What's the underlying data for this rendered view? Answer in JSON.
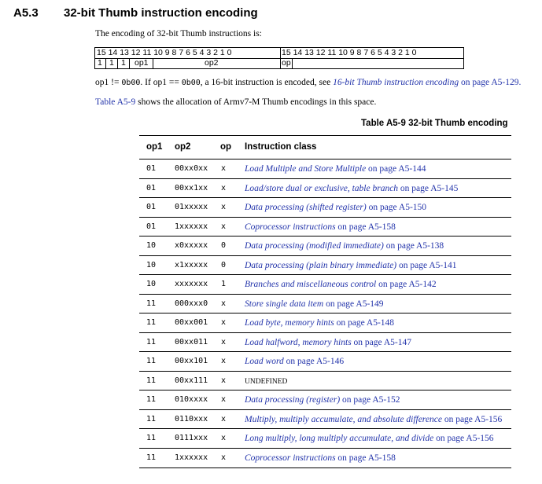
{
  "section": {
    "number": "A5.3",
    "title": "32-bit Thumb instruction encoding"
  },
  "intro": "The encoding of 32-bit Thumb instructions is:",
  "encoding": {
    "bits_hw1": "15 14 13 12 11 10  9  8  7  6  5  4  3  2  1  0",
    "bits_hw2": "15 14 13 12 11 10  9  8  7  6  5  4  3  2  1  0",
    "field_1": "1",
    "field_2": "1",
    "field_3": "1",
    "field_op1": "op1",
    "field_op2": "op2",
    "field_op": "op"
  },
  "para1": {
    "t1": "op1 != ",
    "c1": "0b00",
    "t2": ". If op1 == ",
    "c2": "0b00",
    "t3": ", a 16-bit instruction is encoded, see ",
    "link": "16-bit Thumb instruction encoding",
    "t4": " on page A5-129."
  },
  "para2": {
    "link": "Table A5-9",
    "text": " shows the allocation of Armv7-M Thumb encodings in this space."
  },
  "table": {
    "caption": "Table A5-9 32-bit Thumb encoding",
    "headers": {
      "op1": "op1",
      "op2": "op2",
      "op": "op",
      "cls": "Instruction class"
    },
    "rows": [
      {
        "op1": "01",
        "op2": "00xx0xx",
        "op": "x",
        "link": "Load Multiple and Store Multiple",
        "page": " on page A5-144"
      },
      {
        "op1": "01",
        "op2": "00xx1xx",
        "op": "x",
        "link": "Load/store dual or exclusive, table branch",
        "page": " on page A5-145"
      },
      {
        "op1": "01",
        "op2": "01xxxxx",
        "op": "x",
        "link": "Data processing (shifted register)",
        "page": " on page A5-150"
      },
      {
        "op1": "01",
        "op2": "1xxxxxx",
        "op": "x",
        "link": "Coprocessor instructions",
        "page": " on page A5-158"
      },
      {
        "op1": "10",
        "op2": "x0xxxxx",
        "op": "0",
        "link": "Data processing (modified immediate)",
        "page": " on page A5-138"
      },
      {
        "op1": "10",
        "op2": "x1xxxxx",
        "op": "0",
        "link": "Data processing (plain binary immediate)",
        "page": " on page A5-141"
      },
      {
        "op1": "10",
        "op2": "xxxxxxx",
        "op": "1",
        "link": "Branches and miscellaneous control",
        "page": " on page A5-142"
      },
      {
        "op1": "11",
        "op2": "000xxx0",
        "op": "x",
        "link": "Store single data item",
        "page": " on page A5-149"
      },
      {
        "op1": "11",
        "op2": "00xx001",
        "op": "x",
        "link": "Load byte, memory hints",
        "page": " on page A5-148"
      },
      {
        "op1": "11",
        "op2": "00xx011",
        "op": "x",
        "link": "Load halfword, memory hints",
        "page": " on page A5-147"
      },
      {
        "op1": "11",
        "op2": "00xx101",
        "op": "x",
        "link": "Load word",
        "page": " on page A5-146"
      },
      {
        "op1": "11",
        "op2": "00xx111",
        "op": "x",
        "link": "",
        "page": "UNDEFINED"
      },
      {
        "op1": "11",
        "op2": "010xxxx",
        "op": "x",
        "link": "Data processing (register)",
        "page": " on page A5-152"
      },
      {
        "op1": "11",
        "op2": "0110xxx",
        "op": "x",
        "link": "Multiply, multiply accumulate, and absolute difference",
        "page": " on page A5-156"
      },
      {
        "op1": "11",
        "op2": "0111xxx",
        "op": "x",
        "link": "Long multiply, long multiply accumulate, and divide",
        "page": " on page A5-156"
      },
      {
        "op1": "11",
        "op2": "1xxxxxx",
        "op": "x",
        "link": "Coprocessor instructions",
        "page": " on page A5-158"
      }
    ]
  }
}
